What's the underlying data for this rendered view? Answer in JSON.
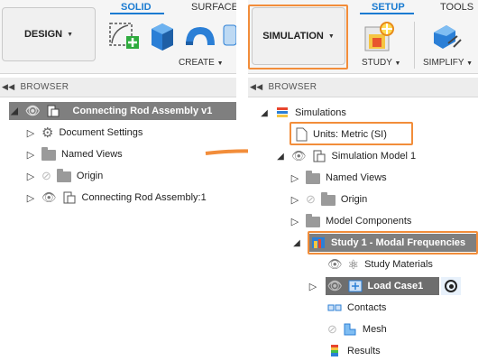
{
  "left": {
    "workspace_label": "DESIGN",
    "tabs": [
      "SOLID",
      "SURFACE"
    ],
    "group_label": "CREATE",
    "browser_label": "BROWSER",
    "tree": {
      "root": "Connecting Rod Assembly v1",
      "document_settings": "Document Settings",
      "named_views": "Named Views",
      "origin": "Origin",
      "component": "Connecting Rod Assembly:1"
    }
  },
  "right": {
    "workspace_label": "SIMULATION",
    "tabs": [
      "SETUP",
      "TOOLS"
    ],
    "groups": [
      "STUDY",
      "SIMPLIFY"
    ],
    "browser_label": "BROWSER",
    "tree": {
      "simulations": "Simulations",
      "units": "Units: Metric (SI)",
      "model": "Simulation Model 1",
      "named_views": "Named Views",
      "origin": "Origin",
      "model_components": "Model Components",
      "study": "Study 1 - Modal Frequencies",
      "study_materials": "Study Materials",
      "load_case": "Load Case1",
      "contacts": "Contacts",
      "mesh": "Mesh",
      "results": "Results"
    }
  },
  "colors": {
    "accent": "#1a7bd1",
    "highlight": "#f28d3a",
    "row_selected": "#7f7f7f"
  }
}
